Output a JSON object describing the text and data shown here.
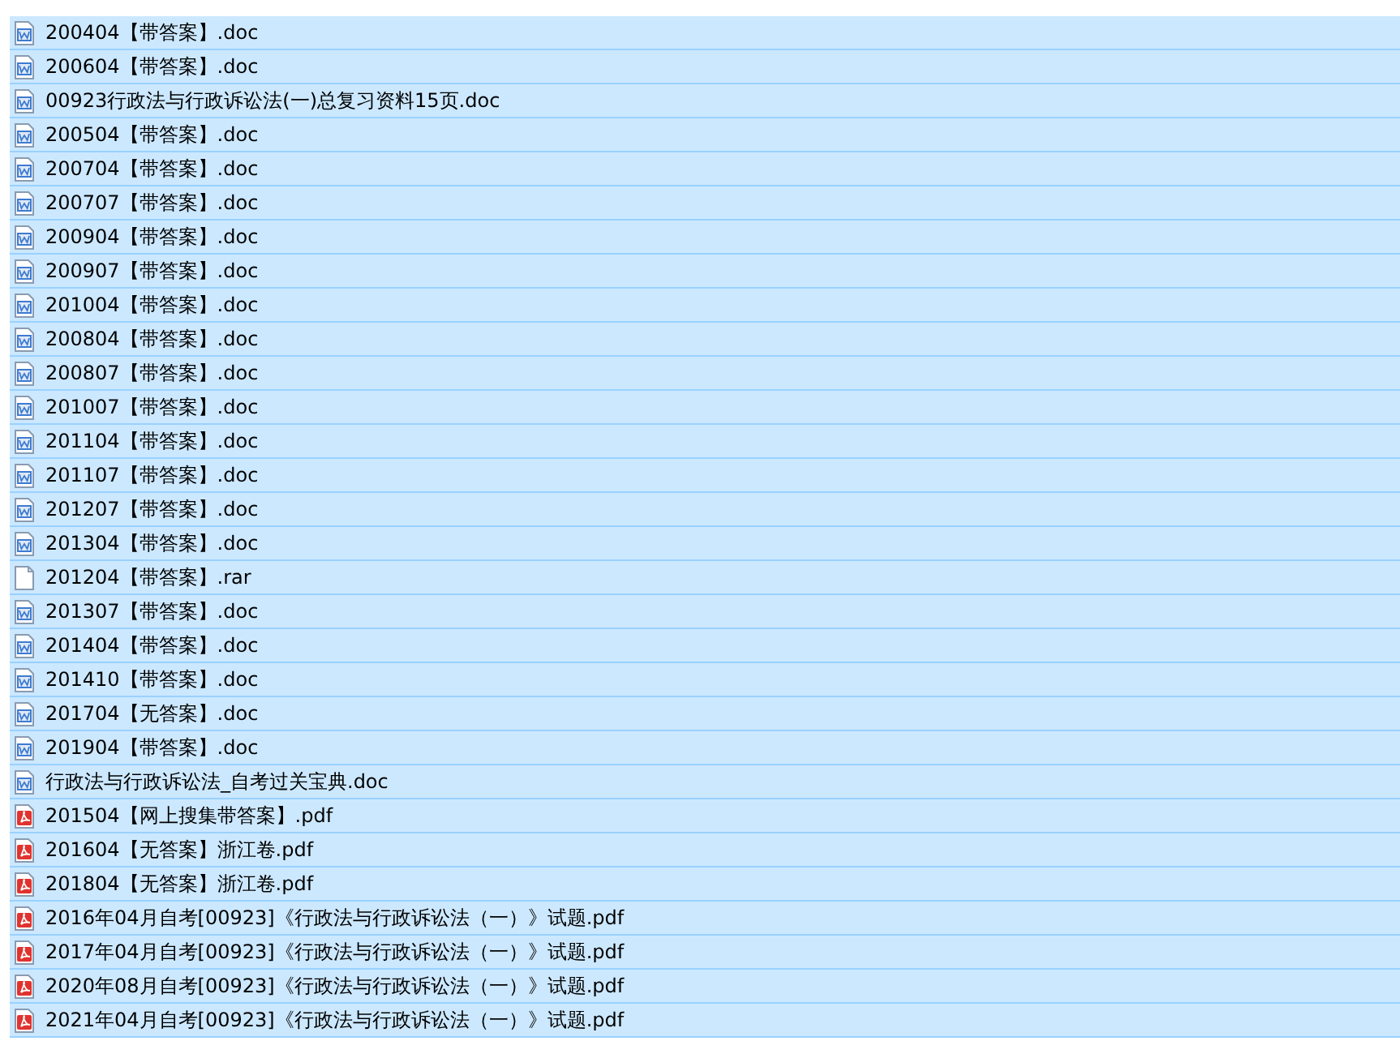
{
  "files": [
    {
      "name": "200404【带答案】.doc",
      "kind": "doc",
      "selected": true
    },
    {
      "name": "200604【带答案】.doc",
      "kind": "doc",
      "selected": true
    },
    {
      "name": "00923行政法与行政诉讼法(一)总复习资料15页.doc",
      "kind": "doc",
      "selected": true
    },
    {
      "name": "200504【带答案】.doc",
      "kind": "doc",
      "selected": true
    },
    {
      "name": "200704【带答案】.doc",
      "kind": "doc",
      "selected": true
    },
    {
      "name": "200707【带答案】.doc",
      "kind": "doc",
      "selected": true
    },
    {
      "name": "200904【带答案】.doc",
      "kind": "doc",
      "selected": true
    },
    {
      "name": "200907【带答案】.doc",
      "kind": "doc",
      "selected": true
    },
    {
      "name": "201004【带答案】.doc",
      "kind": "doc",
      "selected": true
    },
    {
      "name": "200804【带答案】.doc",
      "kind": "doc",
      "selected": true
    },
    {
      "name": "200807【带答案】.doc",
      "kind": "doc",
      "selected": true
    },
    {
      "name": "201007【带答案】.doc",
      "kind": "doc",
      "selected": true
    },
    {
      "name": "201104【带答案】.doc",
      "kind": "doc",
      "selected": true
    },
    {
      "name": "201107【带答案】.doc",
      "kind": "doc",
      "selected": true
    },
    {
      "name": "201207【带答案】.doc",
      "kind": "doc",
      "selected": true
    },
    {
      "name": "201304【带答案】.doc",
      "kind": "doc",
      "selected": true
    },
    {
      "name": "201204【带答案】.rar",
      "kind": "rar",
      "selected": true
    },
    {
      "name": "201307【带答案】.doc",
      "kind": "doc",
      "selected": true
    },
    {
      "name": "201404【带答案】.doc",
      "kind": "doc",
      "selected": true
    },
    {
      "name": "201410【带答案】.doc",
      "kind": "doc",
      "selected": true
    },
    {
      "name": "201704【无答案】.doc",
      "kind": "doc",
      "selected": true
    },
    {
      "name": "201904【带答案】.doc",
      "kind": "doc",
      "selected": true
    },
    {
      "name": "行政法与行政诉讼法_自考过关宝典.doc",
      "kind": "doc",
      "selected": true
    },
    {
      "name": "201504【网上搜集带答案】.pdf",
      "kind": "pdf",
      "selected": true
    },
    {
      "name": "201604【无答案】浙江卷.pdf",
      "kind": "pdf",
      "selected": true
    },
    {
      "name": "201804【无答案】浙江卷.pdf",
      "kind": "pdf",
      "selected": true
    },
    {
      "name": "2016年04月自考[00923]《行政法与行政诉讼法（一）》试题.pdf",
      "kind": "pdf",
      "selected": true
    },
    {
      "name": "2017年04月自考[00923]《行政法与行政诉讼法（一）》试题.pdf",
      "kind": "pdf",
      "selected": true
    },
    {
      "name": "2020年08月自考[00923]《行政法与行政诉讼法（一）》试题.pdf",
      "kind": "pdf",
      "selected": true
    },
    {
      "name": "2021年04月自考[00923]《行政法与行政诉讼法（一）》试题.pdf",
      "kind": "pdf",
      "selected": true
    }
  ]
}
